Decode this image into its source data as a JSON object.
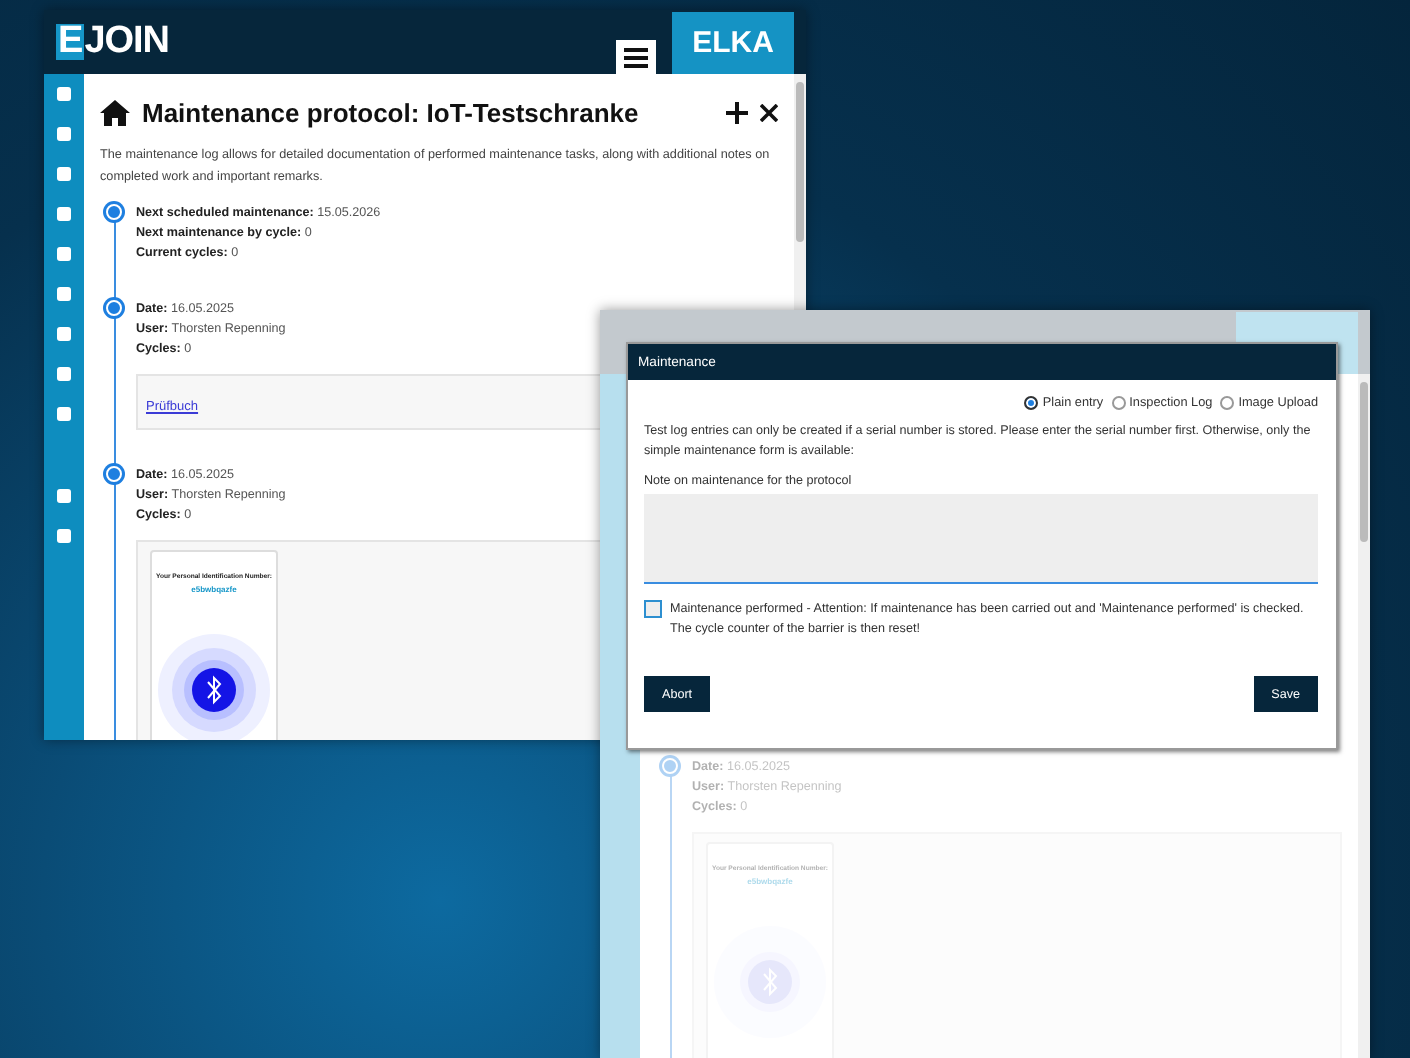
{
  "main_window": {
    "logo_mark": "E",
    "logo_text": "JOIN",
    "brand": "ELKA",
    "title": "Maintenance protocol: IoT-Testschranke",
    "description": "The maintenance log allows for detailed documentation of performed maintenance tasks, along with additional notes on completed work and important remarks.",
    "entries": [
      {
        "fields": [
          {
            "label": "Next scheduled maintenance:",
            "value": "15.05.2026"
          },
          {
            "label": "Next maintenance by cycle:",
            "value": "0"
          },
          {
            "label": "Current cycles:",
            "value": "0"
          }
        ]
      },
      {
        "fields": [
          {
            "label": "Date:",
            "value": "16.05.2025"
          },
          {
            "label": "User:",
            "value": "Thorsten Repenning"
          },
          {
            "label": "Cycles:",
            "value": "0"
          }
        ],
        "attachment": {
          "kind": "link",
          "text": "Prüfbuch"
        }
      },
      {
        "fields": [
          {
            "label": "Date:",
            "value": "16.05.2025"
          },
          {
            "label": "User:",
            "value": "Thorsten Repenning"
          },
          {
            "label": "Cycles:",
            "value": "0"
          }
        ],
        "attachment": {
          "kind": "phone_screenshot",
          "pin_label": "Your Personal Identification Number:",
          "pin": "e5bwbqazfe"
        }
      }
    ]
  },
  "background_window": {
    "entries": [
      {
        "fields": [
          {
            "label": "Date:",
            "value": "16.05.2025"
          },
          {
            "label": "User:",
            "value": "Thorsten Repenning"
          },
          {
            "label": "Cycles:",
            "value": "0"
          }
        ],
        "attachment": {
          "kind": "phone_screenshot",
          "pin_label": "Your Personal Identification Number:",
          "pin": "e5bwbqazfe"
        }
      }
    ]
  },
  "dialog": {
    "title": "Maintenance",
    "entry_types": [
      {
        "label": "Plain entry",
        "selected": true
      },
      {
        "label": "Inspection Log",
        "selected": false
      },
      {
        "label": "Image Upload",
        "selected": false
      }
    ],
    "info": "Test log entries can only be created if a serial number is stored. Please enter the serial number first. Otherwise, only the simple maintenance form is available:",
    "note_label": "Note on maintenance for the protocol",
    "checkbox": {
      "label": "Maintenance performed - Attention: If maintenance has been carried out and 'Maintenance performed' is checked. The cycle counter of the barrier is then reset!",
      "checked": false
    },
    "buttons": [
      {
        "label": "Abort"
      },
      {
        "label": "Save"
      }
    ]
  }
}
